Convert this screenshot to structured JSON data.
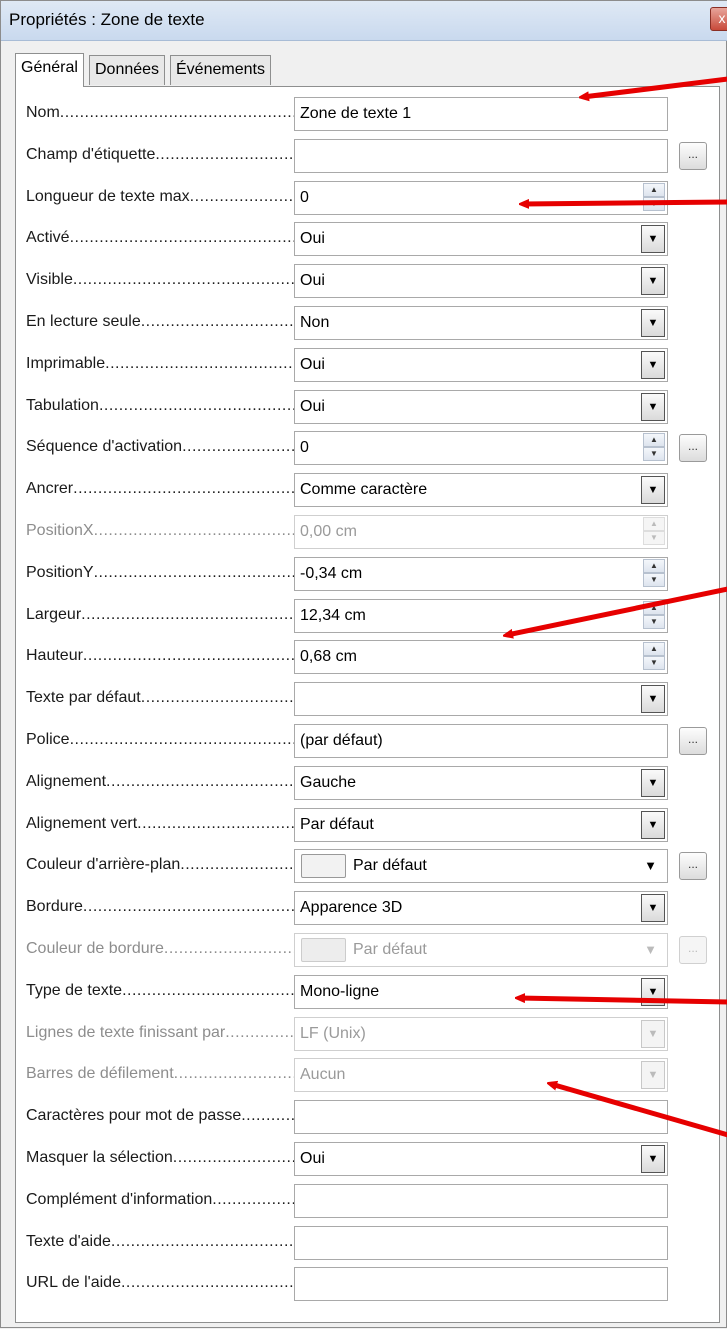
{
  "window": {
    "title": "Propriétés : Zone de texte",
    "close_label": "x"
  },
  "tabs": [
    {
      "label": "Général",
      "active": true
    },
    {
      "label": "Données",
      "active": false
    },
    {
      "label": "Événements",
      "active": false
    }
  ],
  "ellipsis_label": "...",
  "accent_color": "#e60000",
  "rows": [
    {
      "label": "Nom",
      "type": "text",
      "value": "Zone de texte 1",
      "dim": false
    },
    {
      "label": "Champ d'étiquette",
      "type": "text-btn",
      "value": "",
      "dim": false
    },
    {
      "label": "Longueur de texte max",
      "type": "spin",
      "value": "0",
      "dim": false
    },
    {
      "label": "Activé",
      "type": "select",
      "value": "Oui",
      "dim": false
    },
    {
      "label": "Visible",
      "type": "select",
      "value": "Oui",
      "dim": false
    },
    {
      "label": "En lecture seule",
      "type": "select",
      "value": "Non",
      "dim": false
    },
    {
      "label": "Imprimable",
      "type": "select",
      "value": "Oui",
      "dim": false
    },
    {
      "label": "Tabulation",
      "type": "select",
      "value": "Oui",
      "dim": false
    },
    {
      "label": "Séquence d'activation",
      "type": "spin-btn",
      "value": "0",
      "dim": false
    },
    {
      "label": "Ancrer",
      "type": "select",
      "value": "Comme caractère",
      "dim": false
    },
    {
      "label": "PositionX",
      "type": "spin",
      "value": "0,00 cm",
      "dim": true
    },
    {
      "label": "PositionY",
      "type": "spin",
      "value": "-0,34 cm",
      "dim": false
    },
    {
      "label": "Largeur",
      "type": "spin",
      "value": "12,34 cm",
      "dim": false
    },
    {
      "label": "Hauteur",
      "type": "spin",
      "value": "0,68 cm",
      "dim": false
    },
    {
      "label": "Texte par défaut",
      "type": "select",
      "value": "",
      "dim": false
    },
    {
      "label": "Police",
      "type": "text-btn",
      "value": "(par défaut)",
      "dim": false
    },
    {
      "label": "Alignement",
      "type": "select",
      "value": "Gauche",
      "dim": false
    },
    {
      "label": "Alignement vert",
      "type": "select",
      "value": "Par défaut",
      "dim": false
    },
    {
      "label": "Couleur d'arrière-plan",
      "type": "color-btn",
      "value": "Par défaut",
      "dim": false
    },
    {
      "label": "Bordure",
      "type": "select",
      "value": "Apparence 3D",
      "dim": false
    },
    {
      "label": "Couleur de bordure",
      "type": "color-btn",
      "value": "Par défaut",
      "dim": true
    },
    {
      "label": "Type de texte",
      "type": "select",
      "value": "Mono-ligne",
      "dim": false
    },
    {
      "label": "Lignes de texte finissant par",
      "type": "select",
      "value": "LF (Unix)",
      "dim": true
    },
    {
      "label": "Barres de défilement",
      "type": "select",
      "value": "Aucun",
      "dim": true
    },
    {
      "label": "Caractères pour mot de passe",
      "type": "text",
      "value": "",
      "dim": false
    },
    {
      "label": "Masquer la sélection",
      "type": "select",
      "value": "Oui",
      "dim": false
    },
    {
      "label": "Complément d'information",
      "type": "text",
      "value": "",
      "dim": false
    },
    {
      "label": "Texte d'aide",
      "type": "text",
      "value": "",
      "dim": false
    },
    {
      "label": "URL de l'aide",
      "type": "text",
      "value": "",
      "dim": false
    }
  ]
}
